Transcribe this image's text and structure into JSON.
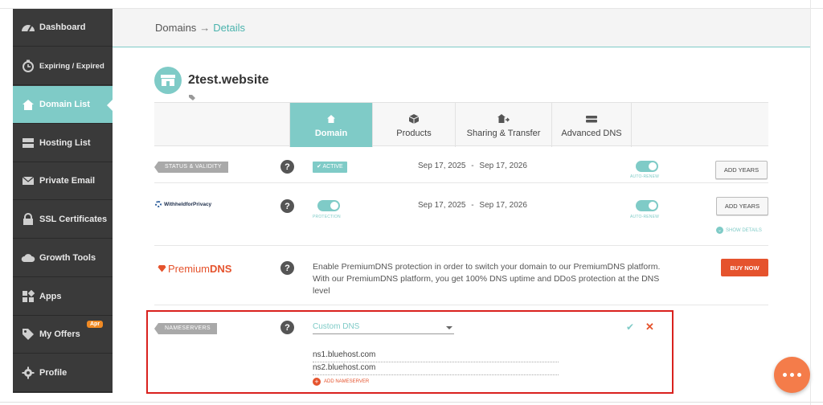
{
  "sidebar": {
    "items": [
      {
        "label": "Dashboard",
        "icon": "gauge-icon"
      },
      {
        "label": "Expiring / Expired",
        "icon": "clock-icon"
      },
      {
        "label": "Domain List",
        "icon": "home-icon",
        "active": true
      },
      {
        "label": "Hosting List",
        "icon": "server-icon"
      },
      {
        "label": "Private Email",
        "icon": "envelope-icon"
      },
      {
        "label": "SSL Certificates",
        "icon": "lock-icon"
      },
      {
        "label": "Growth Tools",
        "icon": "cloud-icon"
      },
      {
        "label": "Apps",
        "icon": "apps-icon"
      },
      {
        "label": "My Offers",
        "icon": "tag-icon",
        "badge": "Apr"
      },
      {
        "label": "Profile",
        "icon": "gear-icon"
      }
    ]
  },
  "breadcrumb": {
    "root": "Domains",
    "separator": "→",
    "current": "Details"
  },
  "domain": {
    "name": "2test.website"
  },
  "tabs": [
    {
      "label": "Domain",
      "icon": "home-icon",
      "active": true
    },
    {
      "label": "Products",
      "icon": "box-icon"
    },
    {
      "label": "Sharing & Transfer",
      "icon": "transfer-icon"
    },
    {
      "label": "Advanced DNS",
      "icon": "dns-server-icon"
    }
  ],
  "status_row": {
    "label": "STATUS & VALIDITY",
    "badge": "ACTIVE",
    "start": "Sep 17, 2025",
    "end": "Sep 17, 2026",
    "autorenew_label": "AUTO-RENEW",
    "button": "ADD YEARS"
  },
  "privacy_row": {
    "brand": "WithheldforPrivacy",
    "protection_label": "PROTECTION",
    "start": "Sep 17, 2025",
    "end": "Sep 17, 2026",
    "autorenew_label": "AUTO-RENEW",
    "button": "ADD YEARS",
    "show_details": "SHOW DETAILS"
  },
  "premium_row": {
    "brand_prefix": "Premium",
    "brand_suffix": "DNS",
    "text": "Enable PremiumDNS protection in order to switch your domain to our PremiumDNS platform. With our PremiumDNS platform, you get 100% DNS uptime and DDoS protection at the DNS level",
    "button": "BUY NOW"
  },
  "nameservers_row": {
    "label": "NAMESERVERS",
    "select_value": "Custom DNS",
    "ns1": "ns1.bluehost.com",
    "ns2": "ns2.bluehost.com",
    "add_label": "ADD NAMESERVER"
  },
  "colors": {
    "accent": "#7fcbc7",
    "sidebar": "#3a3a3a",
    "danger": "#e5532d",
    "highlight": "#d9211e"
  }
}
